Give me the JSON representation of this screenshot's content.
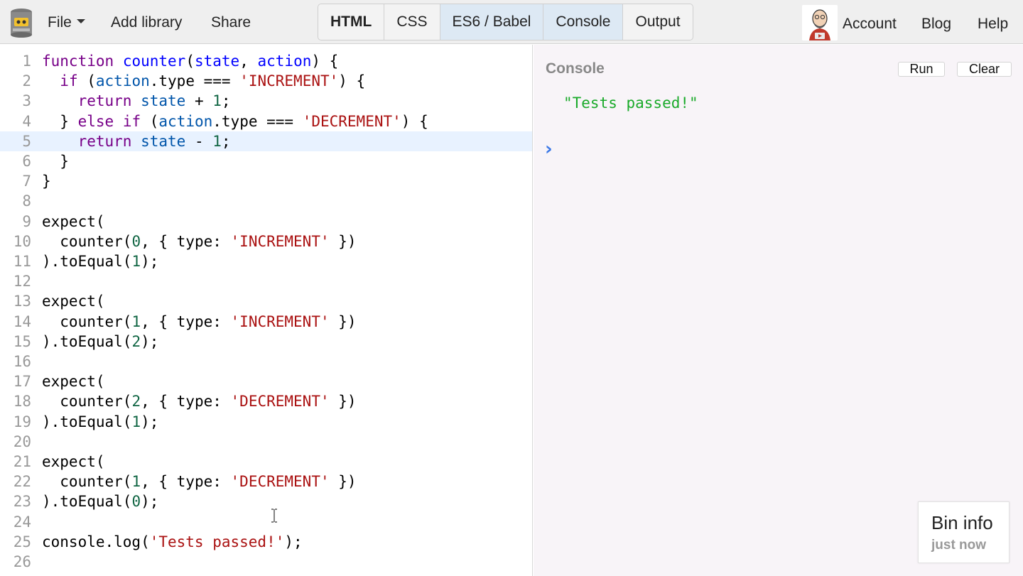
{
  "header": {
    "menu": {
      "file": "File",
      "add_library": "Add library",
      "share": "Share"
    },
    "panel_tabs": [
      {
        "label": "HTML",
        "active": false,
        "bold": true
      },
      {
        "label": "CSS",
        "active": false,
        "bold": false
      },
      {
        "label": "ES6 / Babel",
        "active": true,
        "bold": false
      },
      {
        "label": "Console",
        "active": true,
        "bold": false
      },
      {
        "label": "Output",
        "active": false,
        "bold": false
      }
    ],
    "account": "Account",
    "blog": "Blog",
    "help": "Help"
  },
  "editor": {
    "active_line": 5,
    "lines": [
      [
        [
          "kw",
          "function"
        ],
        [
          "p",
          " "
        ],
        [
          "def",
          "counter"
        ],
        [
          "p",
          "("
        ],
        [
          "def",
          "state"
        ],
        [
          "p",
          ", "
        ],
        [
          "def",
          "action"
        ],
        [
          "p",
          ") {"
        ]
      ],
      [
        [
          "p",
          "  "
        ],
        [
          "kw",
          "if"
        ],
        [
          "p",
          " ("
        ],
        [
          "var",
          "action"
        ],
        [
          "p",
          ".type === "
        ],
        [
          "str",
          "'INCREMENT'"
        ],
        [
          "p",
          ") {"
        ]
      ],
      [
        [
          "p",
          "    "
        ],
        [
          "kw",
          "return"
        ],
        [
          "p",
          " "
        ],
        [
          "var",
          "state"
        ],
        [
          "p",
          " + "
        ],
        [
          "num",
          "1"
        ],
        [
          "p",
          ";"
        ]
      ],
      [
        [
          "p",
          "  } "
        ],
        [
          "kw",
          "else"
        ],
        [
          "p",
          " "
        ],
        [
          "kw",
          "if"
        ],
        [
          "p",
          " ("
        ],
        [
          "var",
          "action"
        ],
        [
          "p",
          ".type === "
        ],
        [
          "str",
          "'DECREMENT'"
        ],
        [
          "p",
          ") {"
        ]
      ],
      [
        [
          "p",
          "    "
        ],
        [
          "kw",
          "return"
        ],
        [
          "p",
          " "
        ],
        [
          "var",
          "state"
        ],
        [
          "p",
          " - "
        ],
        [
          "num",
          "1"
        ],
        [
          "p",
          ";"
        ]
      ],
      [
        [
          "p",
          "  }"
        ]
      ],
      [
        [
          "p",
          "}"
        ]
      ],
      [],
      [
        [
          "p",
          "expect("
        ]
      ],
      [
        [
          "p",
          "  counter("
        ],
        [
          "num",
          "0"
        ],
        [
          "p",
          ", { type: "
        ],
        [
          "str",
          "'INCREMENT'"
        ],
        [
          "p",
          " })"
        ]
      ],
      [
        [
          "p",
          ").toEqual("
        ],
        [
          "num",
          "1"
        ],
        [
          "p",
          ");"
        ]
      ],
      [],
      [
        [
          "p",
          "expect("
        ]
      ],
      [
        [
          "p",
          "  counter("
        ],
        [
          "num",
          "1"
        ],
        [
          "p",
          ", { type: "
        ],
        [
          "str",
          "'INCREMENT'"
        ],
        [
          "p",
          " })"
        ]
      ],
      [
        [
          "p",
          ").toEqual("
        ],
        [
          "num",
          "2"
        ],
        [
          "p",
          ");"
        ]
      ],
      [],
      [
        [
          "p",
          "expect("
        ]
      ],
      [
        [
          "p",
          "  counter("
        ],
        [
          "num",
          "2"
        ],
        [
          "p",
          ", { type: "
        ],
        [
          "str",
          "'DECREMENT'"
        ],
        [
          "p",
          " })"
        ]
      ],
      [
        [
          "p",
          ").toEqual("
        ],
        [
          "num",
          "1"
        ],
        [
          "p",
          ");"
        ]
      ],
      [],
      [
        [
          "p",
          "expect("
        ]
      ],
      [
        [
          "p",
          "  counter("
        ],
        [
          "num",
          "1"
        ],
        [
          "p",
          ", { type: "
        ],
        [
          "str",
          "'DECREMENT'"
        ],
        [
          "p",
          " })"
        ]
      ],
      [
        [
          "p",
          ").toEqual("
        ],
        [
          "num",
          "0"
        ],
        [
          "p",
          ");"
        ]
      ],
      [],
      [
        [
          "p",
          "console.log("
        ],
        [
          "str",
          "'Tests passed!'"
        ],
        [
          "p",
          ");"
        ]
      ],
      []
    ]
  },
  "console": {
    "title": "Console",
    "run_label": "Run",
    "clear_label": "Clear",
    "output": "\"Tests passed!\"",
    "prompt_icon": "chevron-right-icon"
  },
  "bin_info": {
    "title": "Bin info",
    "time": "just now"
  },
  "colors": {
    "keyword": "#770088",
    "definition": "#0000ff",
    "variable": "#0055aa",
    "string": "#aa1111",
    "number": "#116644",
    "console_output": "#1aaa2a",
    "prompt": "#3b78e7",
    "active_tab": "#dde9f4",
    "active_line": "#e8f2ff"
  }
}
